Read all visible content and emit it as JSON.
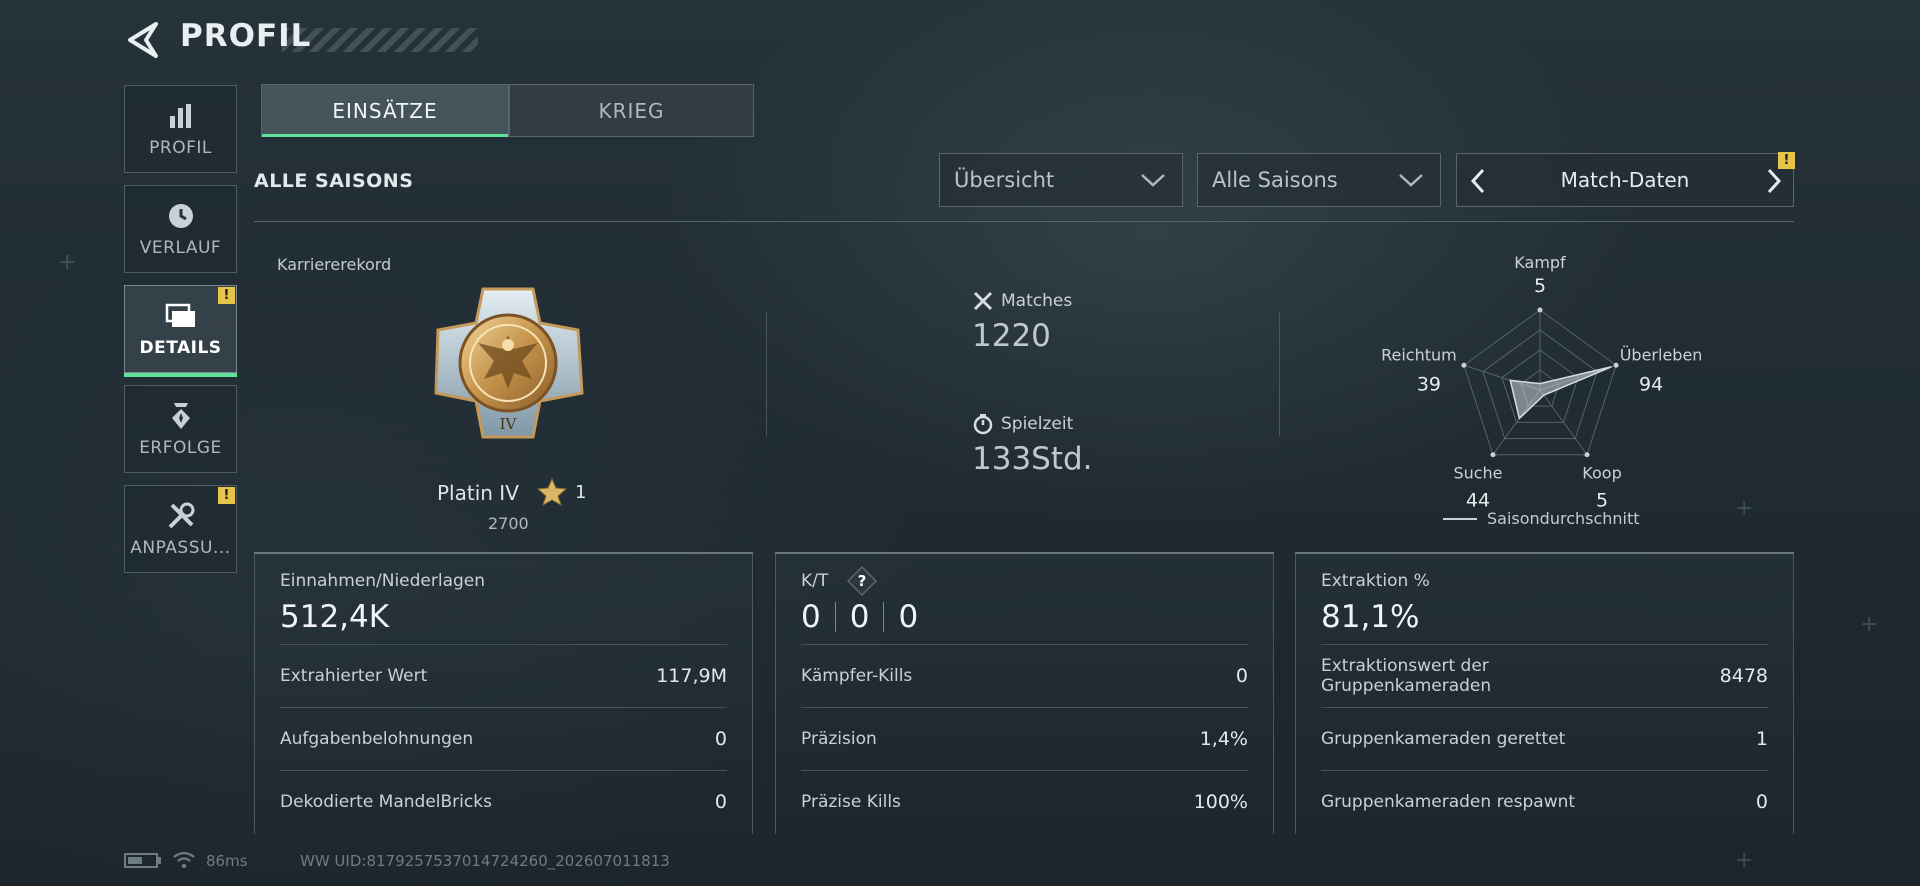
{
  "header": {
    "title": "PROFIL"
  },
  "sidebar": {
    "items": [
      {
        "label": "PROFIL",
        "icon": "bar-chart-icon",
        "active": false,
        "badge": ""
      },
      {
        "label": "VERLAUF",
        "icon": "history-icon",
        "active": false,
        "badge": ""
      },
      {
        "label": "DETAILS",
        "icon": "folders-icon",
        "active": true,
        "badge": "!"
      },
      {
        "label": "ERFOLGE",
        "icon": "achievement-icon",
        "active": false,
        "badge": ""
      },
      {
        "label": "ANPASSU...",
        "icon": "tools-icon",
        "active": false,
        "badge": "!"
      }
    ]
  },
  "tabs": [
    {
      "label": "EINSÄTZE",
      "active": true
    },
    {
      "label": "KRIEG",
      "active": false
    }
  ],
  "section_title": "ALLE SAISONS",
  "filters": {
    "view": "Übersicht",
    "season": "Alle Saisons",
    "match_nav": "Match-Daten",
    "match_nav_badge": "!"
  },
  "career": {
    "label": "Karriererekord",
    "rank": "Platin IV",
    "stars": "1",
    "points": "2700",
    "medal_numeral": "IV"
  },
  "stats": {
    "matches_label": "Matches",
    "matches_value": "1220",
    "time_label": "Spielzeit",
    "time_value": "133Std."
  },
  "radar": {
    "axes": [
      {
        "label": "Kampf",
        "value": "5"
      },
      {
        "label": "Überleben",
        "value": "94"
      },
      {
        "label": "Koop",
        "value": "5"
      },
      {
        "label": "Suche",
        "value": "44"
      },
      {
        "label": "Reichtum",
        "value": "39"
      }
    ],
    "legend": "Saisondurchschnitt"
  },
  "cards": {
    "income": {
      "title": "Einnahmen/Niederlagen",
      "value": "512,4K",
      "rows": [
        {
          "label": "Extrahierter Wert",
          "value": "117,9M"
        },
        {
          "label": "Aufgabenbelohnungen",
          "value": "0"
        },
        {
          "label": "Dekodierte MandelBricks",
          "value": "0"
        }
      ]
    },
    "kd": {
      "title": "K/T",
      "help": "?",
      "values": [
        "0",
        "0",
        "0"
      ],
      "rows": [
        {
          "label": "Kämpfer-Kills",
          "value": "0"
        },
        {
          "label": "Präzision",
          "value": "1,4%"
        },
        {
          "label": "Präzise Kills",
          "value": "100%"
        }
      ]
    },
    "extraction": {
      "title": "Extraktion %",
      "value": "81,1%",
      "rows": [
        {
          "label": "Extraktionswert der",
          "label2": "Gruppenkameraden",
          "value": "8478"
        },
        {
          "label": "Gruppenkameraden gerettet",
          "value": "1"
        },
        {
          "label": "Gruppenkameraden respawnt",
          "value": "0"
        }
      ]
    }
  },
  "footer": {
    "ping": "86ms",
    "uid": "WW UID:8179257537014724260_202607011813"
  },
  "colors": {
    "accent": "#5fe39a",
    "badge": "#e6c44a",
    "background": "#222e35"
  }
}
